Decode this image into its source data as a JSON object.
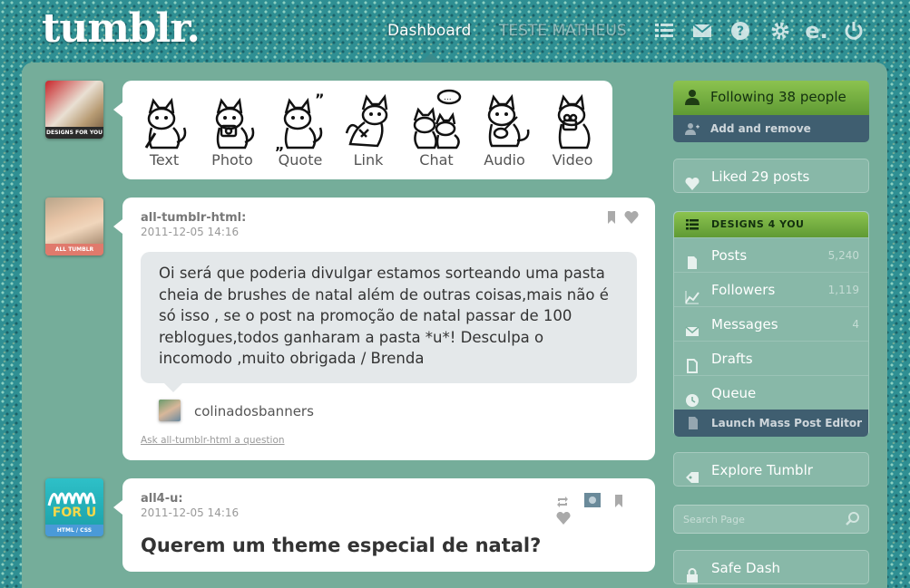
{
  "header": {
    "logo": "tumblr.",
    "nav_dashboard": "Dashboard",
    "nav_blog": "TESTE MATHEUS"
  },
  "post_types": [
    {
      "label": "Text"
    },
    {
      "label": "Photo"
    },
    {
      "label": "Quote"
    },
    {
      "label": "Link"
    },
    {
      "label": "Chat"
    },
    {
      "label": "Audio"
    },
    {
      "label": "Video"
    }
  ],
  "my_avatar_caption": "DESIGNS FOR YOU",
  "posts": [
    {
      "user": "all-tumblr-html:",
      "date": "2011-12-05 14:16",
      "avatar_caption": "ALL TUMBLR",
      "question": "Oi será que poderia divulgar estamos sorteando uma pasta cheia de brushes de natal além de outras coisas,mais não é só isso , se o post na promoção de natal passar de 100 reblogues,todos ganharam a pasta *u*! Desculpa o incomodo ,muito obrigada / Brenda",
      "asker": "colinadosbanners",
      "ask_link": "Ask all-tumblr-html a question"
    },
    {
      "user": "all4-u:",
      "date": "2011-12-05 14:16",
      "avatar_caption": "HTML / CSS",
      "avatar_text": "FOR U",
      "title": "Querem um theme especial de natal?"
    }
  ],
  "sidebar": {
    "following": "Following 38 people",
    "add_remove": "Add and remove",
    "liked": "Liked 29 posts",
    "blog_name": "DESIGNS 4 YOU",
    "items": [
      {
        "label": "Posts",
        "count": "5,240"
      },
      {
        "label": "Followers",
        "count": "1,119"
      },
      {
        "label": "Messages",
        "count": "4"
      },
      {
        "label": "Drafts",
        "count": ""
      },
      {
        "label": "Queue",
        "count": ""
      }
    ],
    "mass_editor": "Launch Mass Post Editor",
    "explore": "Explore Tumblr",
    "search_placeholder": "Search Page",
    "safe_dash": "Safe Dash"
  },
  "colors": {
    "background": "#2f8f93",
    "panel": "#75ad9a",
    "green_header": "#7bb244",
    "dark_bar": "#3f5e70"
  }
}
